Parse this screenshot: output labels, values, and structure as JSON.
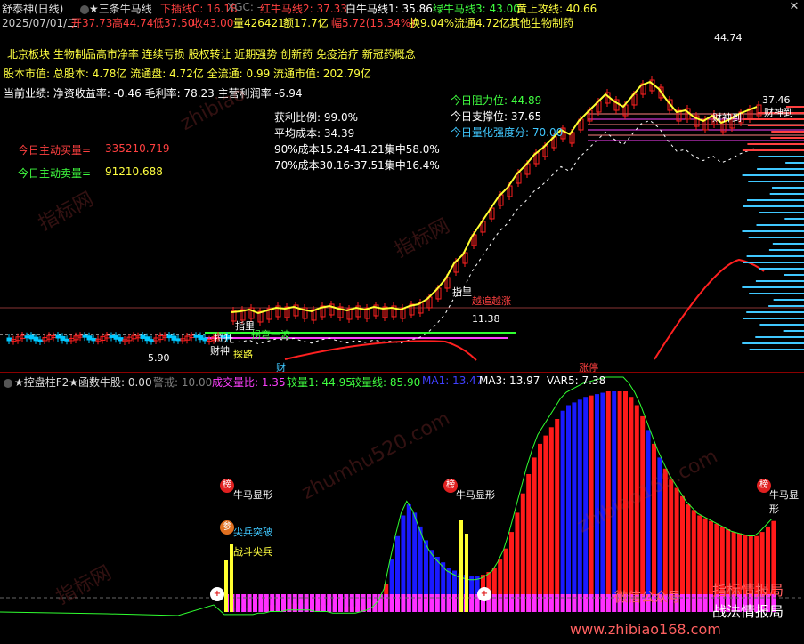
{
  "header": {
    "title": "舒泰神(日线)",
    "strategy": "★三条牛马线",
    "items": [
      {
        "text": "下插线C: 16.18",
        "color": "#ff4040"
      },
      {
        "text": "XGC: -",
        "color": "#808080"
      },
      {
        "text": "红牛马线2: 37.33",
        "color": "#ff4040"
      },
      {
        "text": "白牛马线1: 35.86",
        "color": "#ffffff"
      },
      {
        "text": "绿牛马线3: 43.00",
        "color": "#40ff40"
      },
      {
        "text": "黄上攻线: 40.66",
        "color": "#ffff40"
      }
    ]
  },
  "quote": {
    "date": "2025/07/01/二",
    "open": "开37.73",
    "high": "高44.74",
    "low": "低37.50",
    "close": "收43.00",
    "volume": "量426421",
    "amount": "额17.7亿",
    "change": "幅5.72(15.34%)",
    "turnover": "换9.04%",
    "float": "流通4.72亿",
    "sector": "其他生物制药"
  },
  "concepts": "北京板块  生物制品高市净率 连续亏损 股权转让 近期强势  创新药 免疫治疗 新冠药概念",
  "fundamentals": {
    "line1": "股本市值: 总股本: 4.78亿 流通盘: 4.72亿 全流通: 0.99 流通市值: 202.79亿",
    "line2": "当前业绩: 净资收益率: -0.46 毛利率: 78.23 主营利润率 -6.94"
  },
  "flows": {
    "buy_label": "今日主动买量=",
    "buy_value": "335210.719",
    "sell_label": "今日主动卖量=",
    "sell_value": "91210.688"
  },
  "chips": {
    "profit": "获利比例: 99.0%",
    "avg_cost": "平均成本: 34.39",
    "cost90": "90%成本15.24-41.21集中58.0%",
    "cost70": "70%成本30.16-37.51集中16.4%"
  },
  "levels": {
    "resistance": "今日阻力位:  44.89",
    "support": "今日支撑位:  37.65",
    "strength": "今日量化强度分:  70.00"
  },
  "price_labels": {
    "high": "44.74",
    "low": "5.90",
    "mid": "11.38",
    "right_val": "37.46"
  },
  "chart_tags": {
    "lead": "指里",
    "pull": "拉升",
    "wave": "拐弯一波",
    "explore": "探路",
    "cai": "财神",
    "limitup": "涨停",
    "cai2": "财",
    "caishen_right": "财神到",
    "chase": "越追越涨",
    "r1": "1",
    "rdash": "-"
  },
  "indicator": {
    "title": "★控盘柱F2★",
    "fn": "函数牛股: 0.00",
    "warn": "警戒: 10.00",
    "vol_ratio": "成交量比: 1.35",
    "compare": "较量1: 44.95",
    "compare_line": "较量线: 85.90",
    "ma1": "MA1: 13.47",
    "ma3": "MA3: 13.97",
    "var5": "VAR5: 7.38"
  },
  "signals": {
    "bang": "榜",
    "niuma": "牛马显形",
    "jian": "尖兵突破",
    "shen": "参",
    "zhan": "战斗尖兵",
    "plus": "+"
  },
  "watermarks": {
    "w1": "指标网",
    "w2": "zhibiao",
    "w3": "zhumhu520.com",
    "w4": "zhibiao168.com",
    "footer": "www.zhibiao168.com",
    "wechat": "微信公众号",
    "bureau": "指标情报局",
    "tactic": "战法情报局"
  },
  "colors": {
    "up": "#ff2020",
    "down": "#00c8ff",
    "vol_red": "#ff1a1a",
    "vol_blue": "#1a1aff",
    "vol_mag": "#ff30ff",
    "yellow": "#ffff30",
    "white": "#ffffff"
  },
  "volume_series": [
    3,
    3,
    3,
    3,
    3,
    3,
    4,
    4,
    5,
    5,
    5,
    6,
    6,
    6,
    6,
    6,
    5,
    5,
    5,
    4,
    4,
    4,
    4,
    4,
    5,
    6,
    8,
    12,
    20,
    38,
    55,
    70,
    78,
    72,
    62,
    52,
    45,
    40,
    36,
    32,
    30,
    28,
    27,
    26,
    26,
    27,
    29,
    32,
    38,
    46,
    58,
    72,
    86,
    100,
    112,
    122,
    128,
    134,
    140,
    146,
    150,
    152,
    154,
    156,
    157,
    158,
    159,
    160,
    160,
    160,
    160,
    156,
    150,
    142,
    132,
    122,
    112,
    104,
    96,
    90,
    84,
    78,
    74,
    70,
    68,
    66,
    64,
    62,
    60,
    58,
    57,
    56,
    55,
    55,
    58,
    62,
    66
  ],
  "volume_colors": "rrbbrrbrrbbrrbbrrbbrrrrrrrrrrbbbbbbbbbbbbbbbbrrrrrrrrrrrrrrbbbbbrbbrbrrrrrbrbrrrrrrrrrrrrrrrrrr"
}
